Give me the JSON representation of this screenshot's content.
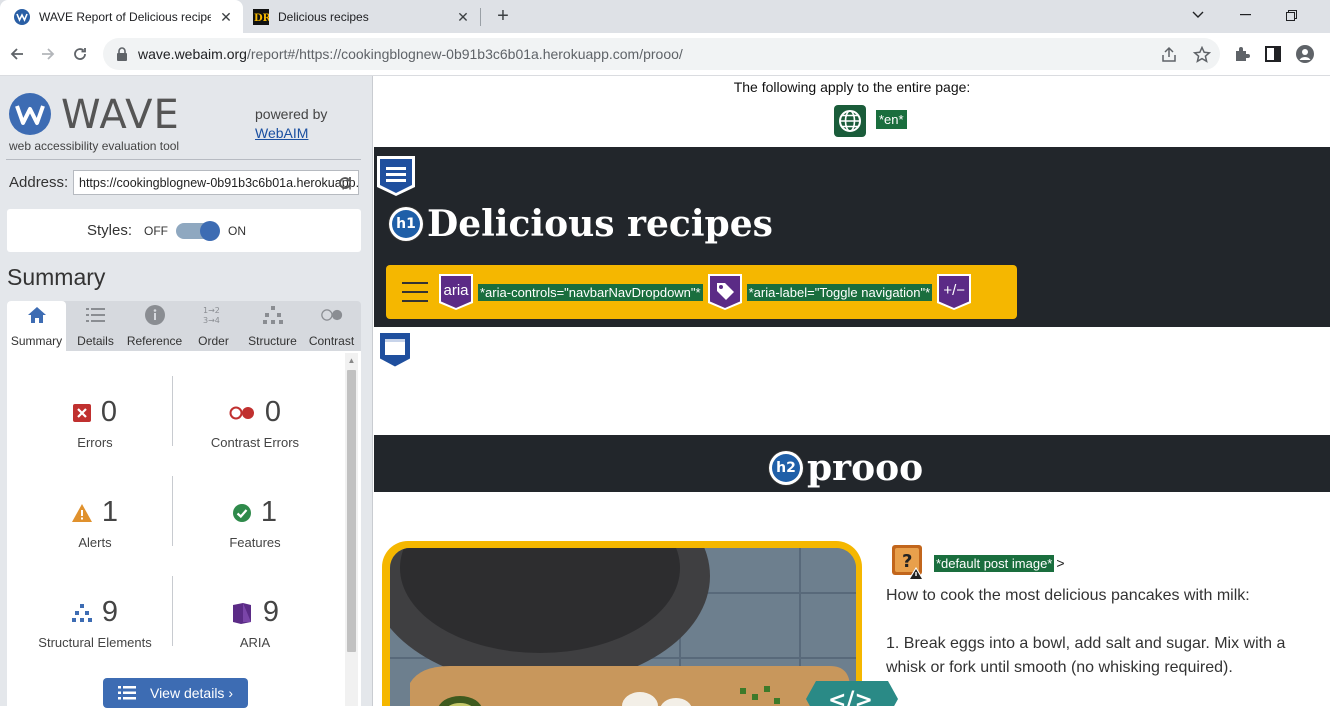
{
  "browser": {
    "tabs": [
      {
        "title": "WAVE Report of Delicious recipe",
        "active": true,
        "favicon": "wave-favicon-icon"
      },
      {
        "title": "Delicious recipes",
        "active": false,
        "favicon": "dr-favicon-icon"
      }
    ],
    "address": {
      "host": "wave.webaim.org",
      "rest": "/report#/https://cookingblognew-0b91b3c6b01a.herokuapp.com/prooo/"
    }
  },
  "wave": {
    "logo_text": "WAVE",
    "subtitle": "web accessibility evaluation tool",
    "powered_by": "powered by",
    "webaim_link": "WebAIM",
    "address_label": "Address:",
    "address_value": "https://cookingblognew-0b91b3c6b01a.herokuapp.com/prooo/",
    "styles_label": "Styles:",
    "styles_off": "OFF",
    "styles_on": "ON",
    "styles_state": "on",
    "summary_heading": "Summary",
    "tabs": [
      {
        "label": "Summary",
        "icon": "home-icon",
        "active": true
      },
      {
        "label": "Details",
        "icon": "list-icon",
        "active": false
      },
      {
        "label": "Reference",
        "icon": "info-icon",
        "active": false
      },
      {
        "label": "Order",
        "icon": "order-icon",
        "active": false
      },
      {
        "label": "Structure",
        "icon": "structure-icon",
        "active": false
      },
      {
        "label": "Contrast",
        "icon": "contrast-icon",
        "active": false
      }
    ],
    "stats": {
      "errors": {
        "count": "0",
        "label": "Errors"
      },
      "contrast_errors": {
        "count": "0",
        "label": "Contrast Errors"
      },
      "alerts": {
        "count": "1",
        "label": "Alerts"
      },
      "features": {
        "count": "1",
        "label": "Features"
      },
      "structural": {
        "count": "9",
        "label": "Structural Elements"
      },
      "aria": {
        "count": "9",
        "label": "ARIA"
      }
    },
    "view_details": "View details ›",
    "colors": {
      "accent": "#3d6cb3",
      "error": "#c0302f",
      "alert": "#e0912d",
      "feature": "#2f8a4b",
      "aria": "#5b2b86"
    }
  },
  "page": {
    "applies_text": "The following apply to the entire page:",
    "lang_tag": "*en*",
    "site_title": "Delicious recipes",
    "h1_badge": "h1",
    "aria_badge": "aria",
    "aria_controls_tag": "*aria-controls=\"navbarNavDropdown\"*",
    "aria_label_tag": "*aria-label=\"Toggle navigation\"*",
    "expand_badge": "+/−",
    "h2_badge": "h2",
    "post_title": "prooo",
    "alt_tag": "*default post image*",
    "alt_suffix": ">",
    "intro": "How to cook the most delicious pancakes with milk:",
    "step1": "1. Break eggs into a bowl, add salt and sugar. Mix with a whisk or fork until smooth (no whisking required).",
    "code_badge": "</>"
  }
}
